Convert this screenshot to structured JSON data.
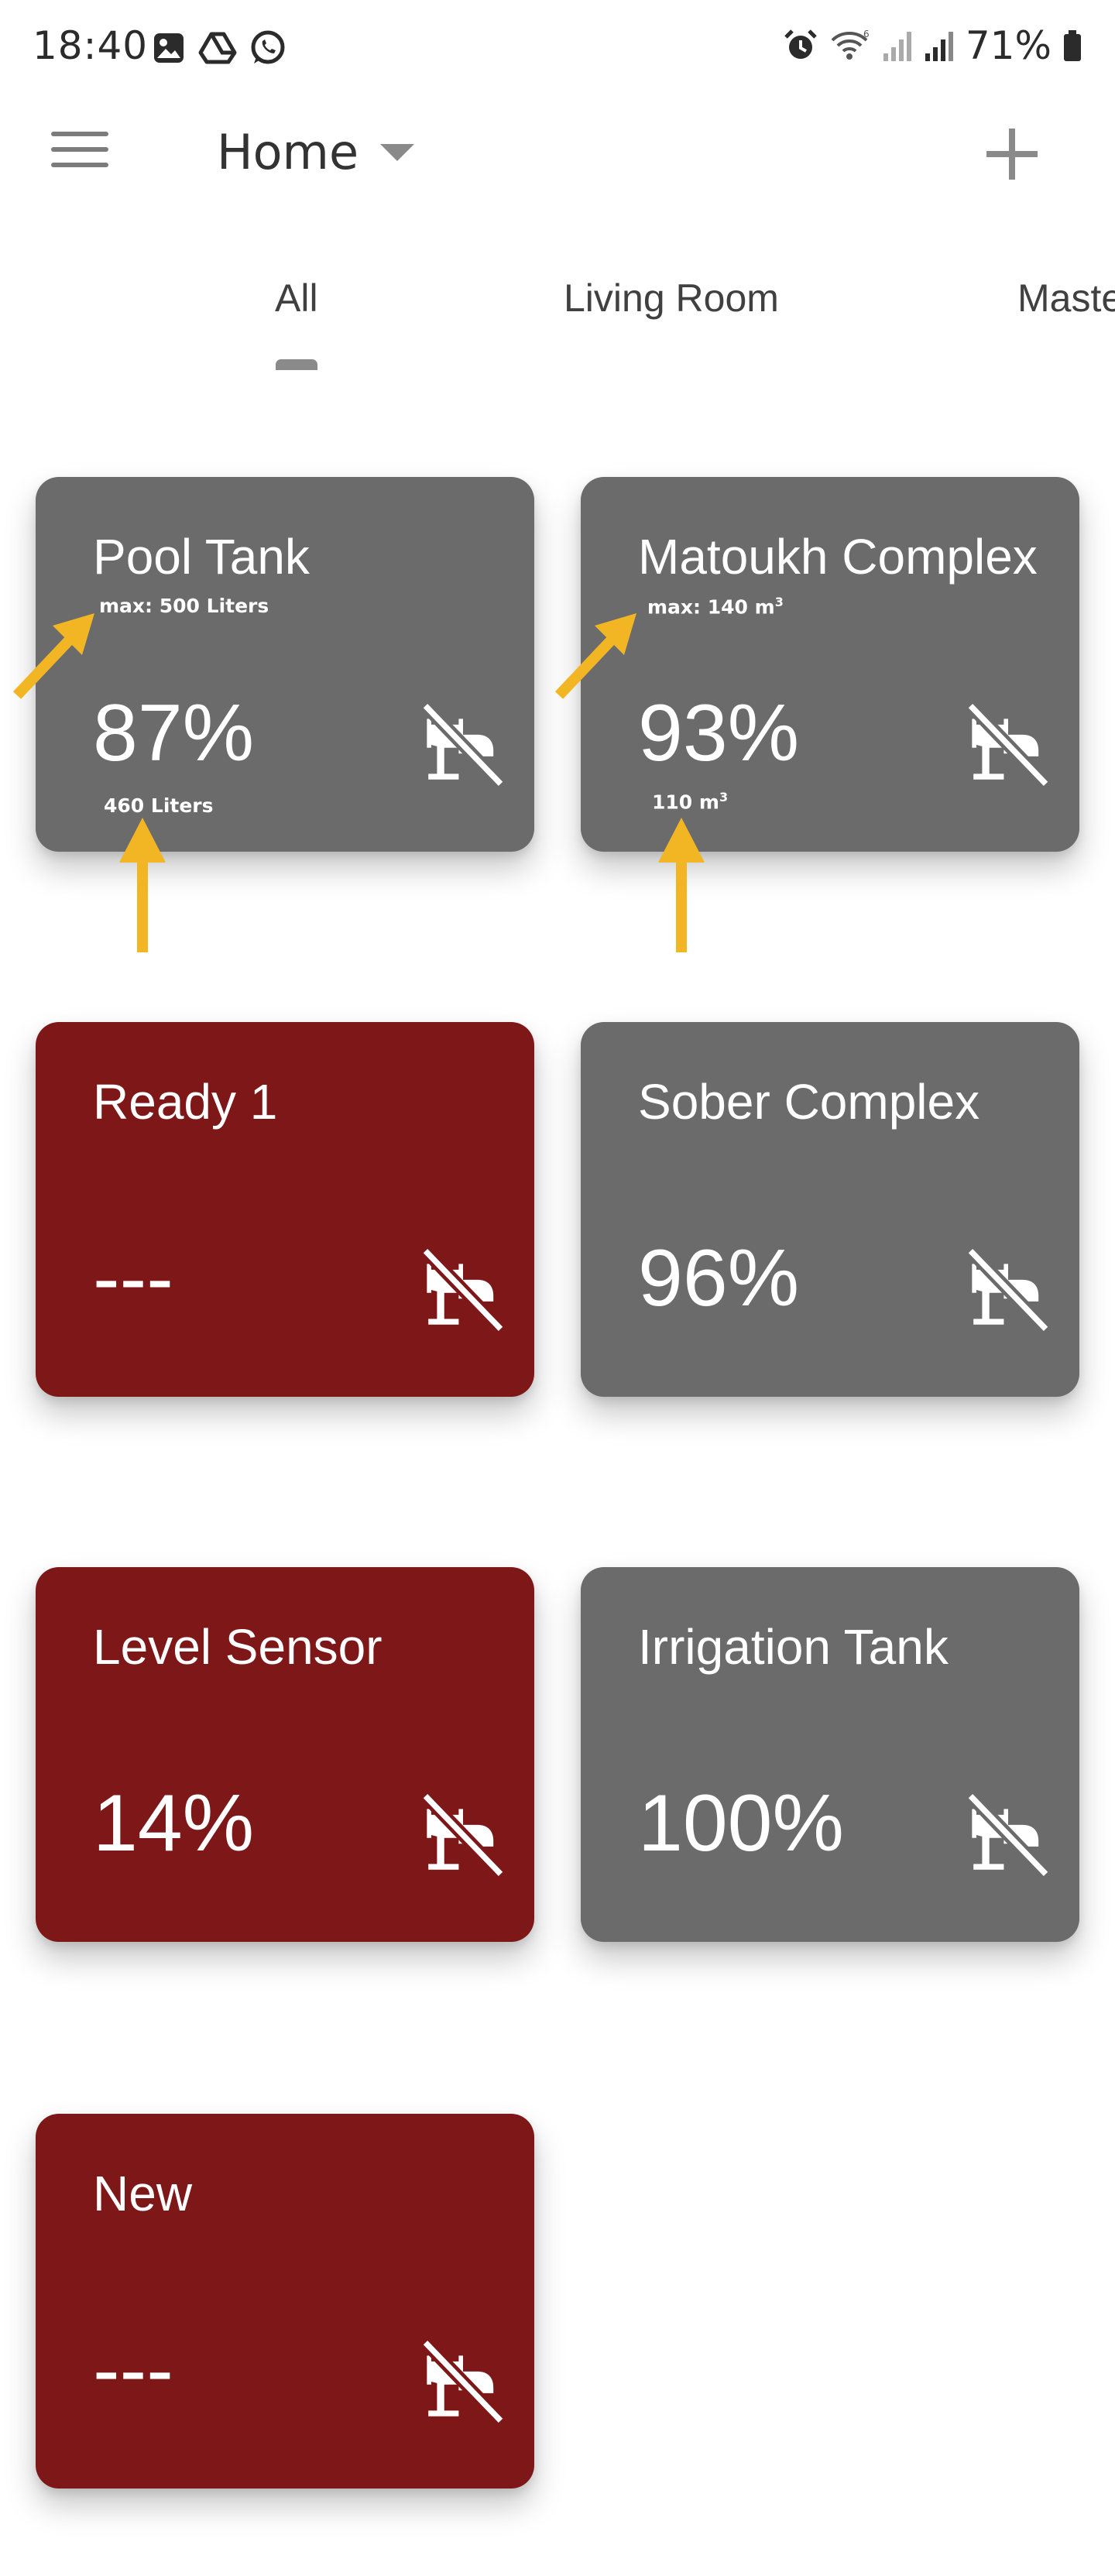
{
  "status_bar": {
    "time": "18:40",
    "battery": "71%",
    "left_icons": [
      "gallery-icon",
      "drive-icon",
      "whatsapp-icon"
    ],
    "right_icons": [
      "alarm-icon",
      "wifi-icon",
      "signal-icon",
      "signal-icon",
      "battery-icon"
    ]
  },
  "app_bar": {
    "title": "Home"
  },
  "tabs": [
    {
      "label": "All",
      "active": true
    },
    {
      "label": "Living Room",
      "active": false
    },
    {
      "label": "Maste",
      "active": false
    }
  ],
  "cards": [
    {
      "title": "Pool Tank",
      "max_label": "max: 500 Liters",
      "value": "87%",
      "volume": "460 Liters",
      "status": "gray",
      "icon": "tap-off-icon"
    },
    {
      "title": "Matoukh Complex",
      "max_label": "max: 140 m",
      "max_unit_sup": "3",
      "value": "93%",
      "volume": "110 m",
      "volume_unit_sup": "3",
      "status": "gray",
      "icon": "tap-off-icon"
    },
    {
      "title": "Ready 1",
      "value": "---",
      "status": "red",
      "icon": "tap-off-icon"
    },
    {
      "title": "Sober Complex",
      "value": "96%",
      "status": "gray",
      "icon": "tap-off-icon"
    },
    {
      "title": "Level Sensor",
      "value": "14%",
      "status": "red",
      "icon": "tap-off-icon"
    },
    {
      "title": "Irrigation Tank",
      "value": "100%",
      "status": "gray",
      "icon": "tap-off-icon"
    },
    {
      "title": "New",
      "value": "---",
      "status": "red",
      "icon": "tap-off-icon"
    }
  ],
  "colors": {
    "card_gray": "#6b6b6b",
    "card_red": "#7e1818",
    "arrow_yellow": "#f2b625"
  }
}
